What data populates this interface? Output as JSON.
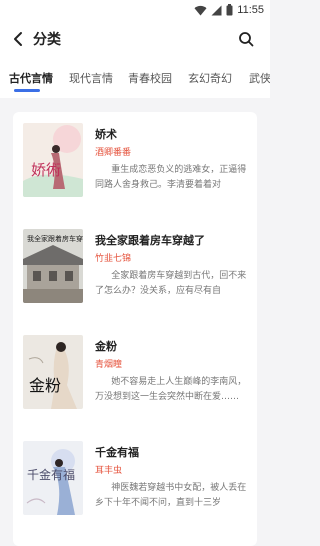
{
  "status_bar": {
    "time": "11:55"
  },
  "header": {
    "title": "分类"
  },
  "tabs": [
    {
      "label": "古代言情",
      "active": true
    },
    {
      "label": "现代言情",
      "active": false
    },
    {
      "label": "青春校园",
      "active": false
    },
    {
      "label": "玄幻奇幻",
      "active": false
    },
    {
      "label": "武侠",
      "active": false
    }
  ],
  "books": [
    {
      "title": "娇术",
      "author": "酒卿番番",
      "description": "重生成恋恶负义的逃难女，正逼得同路人舍身救己。李清要着着对面……",
      "cover_text": "娇術"
    },
    {
      "title": "我全家跟着房车穿越了",
      "author": "竹韭七锦",
      "description": "全家跟着房车穿越到古代，回不来了怎么办？没关系，应有尽有自带……",
      "cover_text": "我全家跟着房车穿越了"
    },
    {
      "title": "金粉",
      "author": "青烟瞳",
      "description": "她不容易走上人生巅峰的李南风，万没想到这一生会突然中断在爱……",
      "cover_text": "金粉"
    },
    {
      "title": "千金有福",
      "author": "耳丰虫",
      "description": "神医魏若穿越书中女配，被人丢在乡下十年不闻不问，直到十三岁才……",
      "cover_text": "千金有福"
    }
  ],
  "colors": {
    "accent": "#3b6fe6",
    "author": "#e5533d"
  }
}
